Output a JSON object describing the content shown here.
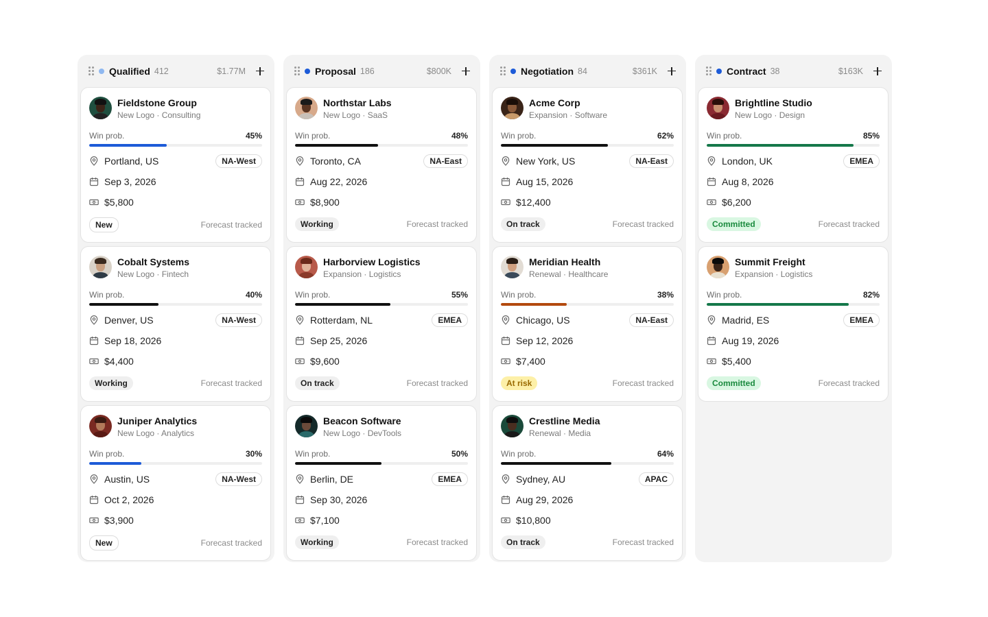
{
  "columns": [
    {
      "title": "Qualified",
      "count": "412",
      "total": "$1.77M",
      "dot_color": "#8fb8f0",
      "cards": [
        {
          "company": "Fieldstone Group",
          "type": "New Logo · Consulting",
          "prob_label": "Win prob.",
          "prob": "45%",
          "prob_value": 0.45,
          "bar_color": "#1d5bd8",
          "location": "Portland, US",
          "region": "NA-West",
          "date": "Sep 3, 2026",
          "amount": "$5,800",
          "status": "New",
          "status_kind": "new",
          "forecast": "Forecast tracked",
          "avatar": {
            "bg": "#1f4f3f",
            "skin": "#3b2418",
            "hair": "#111111",
            "shirt": "#222222"
          }
        },
        {
          "company": "Cobalt Systems",
          "type": "New Logo · Fintech",
          "prob_label": "Win prob.",
          "prob": "40%",
          "prob_value": 0.4,
          "bar_color": "#111111",
          "location": "Denver, US",
          "region": "NA-West",
          "date": "Sep 18, 2026",
          "amount": "$4,400",
          "status": "Working",
          "status_kind": "working",
          "forecast": "Forecast tracked",
          "avatar": {
            "bg": "#d9d2c8",
            "skin": "#c9a081",
            "hair": "#3a2a1e",
            "shirt": "#2f3b45"
          }
        },
        {
          "company": "Juniper Analytics",
          "type": "New Logo · Analytics",
          "prob_label": "Win prob.",
          "prob": "30%",
          "prob_value": 0.3,
          "bar_color": "#1d5bd8",
          "location": "Austin, US",
          "region": "NA-West",
          "date": "Oct 2, 2026",
          "amount": "$3,900",
          "status": "New",
          "status_kind": "new",
          "forecast": "Forecast tracked",
          "avatar": {
            "bg": "#7a2a22",
            "skin": "#b27a5a",
            "hair": "#3a1a12",
            "shirt": "#5a1a14"
          }
        }
      ]
    },
    {
      "title": "Proposal",
      "count": "186",
      "total": "$800K",
      "dot_color": "#1d5bd8",
      "cards": [
        {
          "company": "Northstar Labs",
          "type": "New Logo · SaaS",
          "prob_label": "Win prob.",
          "prob": "48%",
          "prob_value": 0.48,
          "bar_color": "#111111",
          "location": "Toronto, CA",
          "region": "NA-East",
          "date": "Aug 22, 2026",
          "amount": "$8,900",
          "status": "Working",
          "status_kind": "working",
          "forecast": "Forecast tracked",
          "avatar": {
            "bg": "#d7a98a",
            "skin": "#5a3522",
            "hair": "#1a1a1a",
            "shirt": "#c8c0b8"
          }
        },
        {
          "company": "Harborview Logistics",
          "type": "Expansion · Logistics",
          "prob_label": "Win prob.",
          "prob": "55%",
          "prob_value": 0.55,
          "bar_color": "#111111",
          "location": "Rotterdam, NL",
          "region": "EMEA",
          "date": "Sep 25, 2026",
          "amount": "$9,600",
          "status": "On track",
          "status_kind": "ontrack",
          "forecast": "Forecast tracked",
          "avatar": {
            "bg": "#b85a4a",
            "skin": "#e0b49a",
            "hair": "#6a2a1a",
            "shirt": "#8a3a2a"
          }
        },
        {
          "company": "Beacon Software",
          "type": "New Logo · DevTools",
          "prob_label": "Win prob.",
          "prob": "50%",
          "prob_value": 0.5,
          "bar_color": "#111111",
          "location": "Berlin, DE",
          "region": "EMEA",
          "date": "Sep 30, 2026",
          "amount": "$7,100",
          "status": "Working",
          "status_kind": "working",
          "forecast": "Forecast tracked",
          "avatar": {
            "bg": "#142a2a",
            "skin": "#6a4a3a",
            "hair": "#0a0a0a",
            "shirt": "#2a6a6a"
          }
        }
      ]
    },
    {
      "title": "Negotiation",
      "count": "84",
      "total": "$361K",
      "dot_color": "#1d5bd8",
      "cards": [
        {
          "company": "Acme Corp",
          "type": "Expansion · Software",
          "prob_label": "Win prob.",
          "prob": "62%",
          "prob_value": 0.62,
          "bar_color": "#111111",
          "location": "New York, US",
          "region": "NA-East",
          "date": "Aug 15, 2026",
          "amount": "$12,400",
          "status": "On track",
          "status_kind": "ontrack",
          "forecast": "Forecast tracked",
          "avatar": {
            "bg": "#3a2418",
            "skin": "#8a5a3a",
            "hair": "#1a0e08",
            "shirt": "#c89a6a"
          }
        },
        {
          "company": "Meridian Health",
          "type": "Renewal · Healthcare",
          "prob_label": "Win prob.",
          "prob": "38%",
          "prob_value": 0.38,
          "bar_color": "#b34a0e",
          "location": "Chicago, US",
          "region": "NA-East",
          "date": "Sep 12, 2026",
          "amount": "$7,400",
          "status": "At risk",
          "status_kind": "atrisk",
          "forecast": "Forecast tracked",
          "avatar": {
            "bg": "#e2dcd4",
            "skin": "#d0a080",
            "hair": "#2a1e16",
            "shirt": "#3a4a5a"
          }
        },
        {
          "company": "Crestline Media",
          "type": "Renewal · Media",
          "prob_label": "Win prob.",
          "prob": "64%",
          "prob_value": 0.64,
          "bar_color": "#111111",
          "location": "Sydney, AU",
          "region": "APAC",
          "date": "Aug 29, 2026",
          "amount": "$10,800",
          "status": "On track",
          "status_kind": "ontrack",
          "forecast": "Forecast tracked",
          "avatar": {
            "bg": "#1a4a3a",
            "skin": "#4a2e20",
            "hair": "#0e0e0e",
            "shirt": "#1a1a1a"
          }
        }
      ]
    },
    {
      "title": "Contract",
      "count": "38",
      "total": "$163K",
      "dot_color": "#1d5bd8",
      "cards": [
        {
          "company": "Brightline Studio",
          "type": "New Logo · Design",
          "prob_label": "Win prob.",
          "prob": "85%",
          "prob_value": 0.85,
          "bar_color": "#15784a",
          "location": "London, UK",
          "region": "EMEA",
          "date": "Aug 8, 2026",
          "amount": "$6,200",
          "status": "Committed",
          "status_kind": "committed",
          "forecast": "Forecast tracked",
          "avatar": {
            "bg": "#8a2a32",
            "skin": "#c89070",
            "hair": "#2a0e0a",
            "shirt": "#6a1a20"
          }
        },
        {
          "company": "Summit Freight",
          "type": "Expansion · Logistics",
          "prob_label": "Win prob.",
          "prob": "82%",
          "prob_value": 0.82,
          "bar_color": "#15784a",
          "location": "Madrid, ES",
          "region": "EMEA",
          "date": "Aug 19, 2026",
          "amount": "$5,400",
          "status": "Committed",
          "status_kind": "committed",
          "forecast": "Forecast tracked",
          "avatar": {
            "bg": "#d8a070",
            "skin": "#3a2418",
            "hair": "#0a0a0a",
            "shirt": "#e8e0d0"
          }
        }
      ]
    }
  ]
}
